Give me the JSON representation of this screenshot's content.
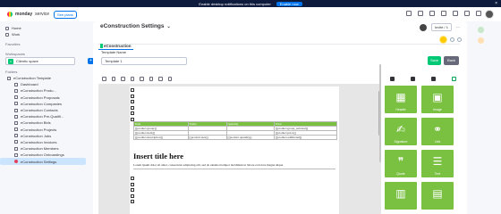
{
  "notification": {
    "text": "Enable desktop notifications on this computer",
    "action": "Enable now"
  },
  "topbar": {
    "brand_bold": "monday",
    "brand_rest": "service",
    "see_plans": "See plans"
  },
  "sidebar": {
    "nav": [
      {
        "label": "Home",
        "icon": "home-icon"
      },
      {
        "label": "Work",
        "icon": "my-work-icon"
      }
    ],
    "favorites_label": "Favorites",
    "workspaces_label": "Workspaces",
    "workspace": {
      "badge": "C",
      "name": "Clientic space"
    },
    "folders_label": "Folders",
    "boards": [
      "eConstruction Template",
      "Dashboard",
      "eConstruction Produ...",
      "eConstruction Proposals",
      "eConstruction Companies",
      "eConstruction Contacts",
      "eConstruction Pre-Qualifi...",
      "eConstruction Bids",
      "eConstruction Projects",
      "eConstruction Jobs",
      "eConstruction Invoices",
      "eConstruction Members",
      "eConstruction Onboardings",
      "eConstruction Settings"
    ]
  },
  "main": {
    "title": "eConstruction Settings",
    "invite": "Invite / 1",
    "tab": "eConstruction",
    "template_name_label": "Template Name",
    "template_name_value": "Template 1",
    "save": "Save",
    "back": "Back"
  },
  "document": {
    "table_header": [
      "Item",
      "Name",
      "Quantity",
      "Price"
    ],
    "rows": [
      [
        "[[product.group]]",
        "",
        "",
        "[[product.group_subtotal]]"
      ],
      [
        "[[product.item]]",
        "",
        "",
        "[[product.price]]"
      ],
      [
        "[[product.description]]",
        "[[product.size]]",
        "[[product.quantity]]",
        "[[product.additional]]"
      ]
    ],
    "heading": "Insert title here",
    "body": "Lorem ipsum dolor sit amet, consectetur adipiscing elit, sed do eiusmod tempor incididunt ut labore et dolore magna aliqua"
  },
  "blocks": [
    {
      "label": "Header",
      "icon": "header-block-icon",
      "glyph": "▦"
    },
    {
      "label": "Image",
      "icon": "image-block-icon",
      "glyph": "▣"
    },
    {
      "label": "Signature",
      "icon": "signature-block-icon",
      "glyph": "✍"
    },
    {
      "label": "Link",
      "icon": "link-block-icon",
      "glyph": "⚭"
    },
    {
      "label": "Quote",
      "icon": "quote-block-icon",
      "glyph": "❞"
    },
    {
      "label": "Text",
      "icon": "text-block-icon",
      "glyph": "☰"
    },
    {
      "label": "",
      "icon": "block-icon",
      "glyph": "▥"
    },
    {
      "label": "",
      "icon": "block-icon",
      "glyph": "▤"
    }
  ],
  "colors": {
    "accent": "#0073ea",
    "block_green": "#7ac142",
    "save_green": "#00c875"
  }
}
